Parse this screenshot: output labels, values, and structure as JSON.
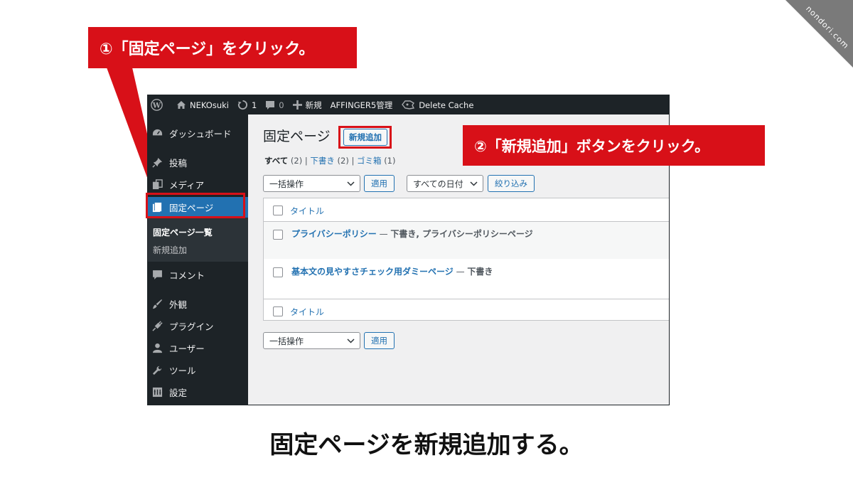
{
  "watermark": "nondori.com",
  "admin_bar": {
    "wp_logo": "wordpress-icon",
    "site_name": "NEKOsuki",
    "updates_count": "1",
    "comments_count": "0",
    "new_label": "新規",
    "affinger_label": "AFFINGER5管理",
    "delete_cache_label": "Delete Cache"
  },
  "sidebar": {
    "items": [
      {
        "label": "ダッシュボード",
        "icon": "dashboard-icon"
      },
      {
        "label": "投稿",
        "icon": "pin-icon"
      },
      {
        "label": "メディア",
        "icon": "media-icon"
      },
      {
        "label": "固定ページ",
        "icon": "pages-icon"
      },
      {
        "label": "コメント",
        "icon": "comment-icon"
      },
      {
        "label": "外観",
        "icon": "appearance-icon"
      },
      {
        "label": "プラグイン",
        "icon": "plugin-icon"
      },
      {
        "label": "ユーザー",
        "icon": "user-icon"
      },
      {
        "label": "ツール",
        "icon": "wrench-icon"
      },
      {
        "label": "設定",
        "icon": "settings-icon"
      }
    ],
    "submenu": [
      "固定ページ一覧",
      "新規追加"
    ]
  },
  "main": {
    "title": "固定ページ",
    "add_new_label": "新規追加",
    "filters": {
      "all_label": "すべて",
      "all_count": "(2)",
      "sep": "|",
      "draft_label": "下書き",
      "draft_count": "(2)",
      "trash_label": "ゴミ箱",
      "trash_count": "(1)"
    },
    "bulk_action": "一括操作",
    "apply_label": "適用",
    "date_filter": "すべての日付",
    "filter_button": "絞り込み",
    "column_title": "タイトル",
    "rows": [
      {
        "title": "プライバシーポリシー",
        "sep": " — ",
        "state": "下書き, プライバシーポリシーページ"
      },
      {
        "title": "基本文の見やすさチェック用ダミーページ",
        "sep": " — ",
        "state": "下書き"
      }
    ]
  },
  "annotations": {
    "step1": "①「固定ページ」をクリック。",
    "step2": "②「新規追加」ボタンをクリック。",
    "accent_color": "#d81018"
  },
  "caption": "固定ページを新規追加する。"
}
